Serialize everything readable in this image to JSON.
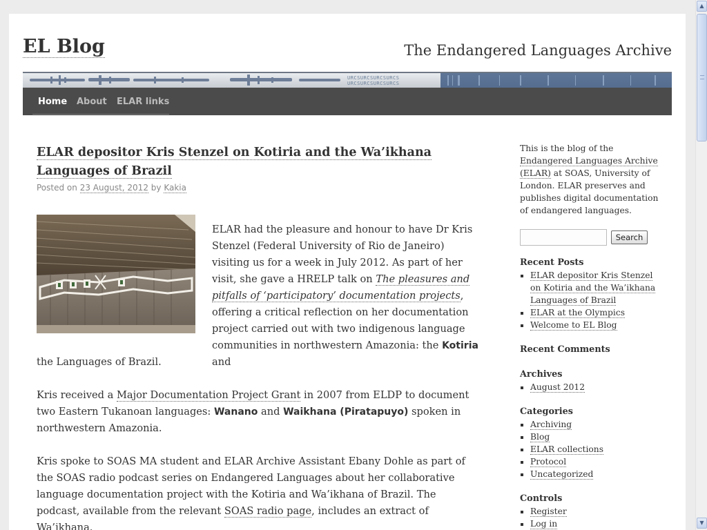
{
  "site": {
    "title": "EL Blog",
    "description": "The Endangered Languages Archive",
    "banner_text": "URCSURCSURCSURCS\nURCSURCSURCSURCS"
  },
  "nav": {
    "items": [
      "Home",
      "About",
      "ELAR links"
    ],
    "active": "Home"
  },
  "post": {
    "title": "ELAR depositor Kris Stenzel on Kotiria and the Wa’ikhana Languages of Brazil",
    "meta_prefix": "Posted on",
    "date": "23 August, 2012",
    "meta_by": "by",
    "author": "Kakia",
    "p1_a": "ELAR had the pleasure and honour to have Dr Kris Stenzel (Federal University of Rio de Janeiro) visiting us for a week in July 2012. As part of her visit, she gave a HRELP talk on ",
    "p1_link": "The pleasures and pitfalls of ‘participatory’ documentation projects",
    "p1_b": ", offering a critical reflection on her documentation project carried out with two indigenous language communities in northwestern Amazonia: the ",
    "p1_lang": "Kotiria",
    "p1_c": " and",
    "p1_d": "the Languages of Brazil.",
    "p2_a": "Kris received a ",
    "p2_link": "Major Documentation Project Grant",
    "p2_b": " in 2007 from ELDP to document two Eastern Tukanoan languages: ",
    "p2_lang1": "Wanano",
    "p2_c": " and ",
    "p2_lang2": "Waikhana (Piratapuyo)",
    "p2_d": " spoken in northwestern Amazonia.",
    "p3_a": "Kris spoke to SOAS MA student and ELAR Archive Assistant Ebany Dohle as part of the SOAS radio podcast series on Endangered Languages about her collaborative language documentation project with the Kotiria and Wa’ikhana of Brazil. The podcast, available from the relevant ",
    "p3_link": "SOAS radio page",
    "p3_b": ", includes an extract of Wa’ikhana."
  },
  "sidebar": {
    "intro_a": "This is the blog of the ",
    "intro_link": "Endangered Languages Archive (ELAR)",
    "intro_b": " at SOAS, University of London. ELAR preserves and publishes digital documentation of endangered languages.",
    "search_placeholder": "",
    "search_button": "Search",
    "recent_posts_title": "Recent Posts",
    "recent_posts": [
      "ELAR depositor Kris Stenzel on Kotiria and the Wa’ikhana Languages of Brazil",
      "ELAR at the Olympics",
      "Welcome to EL Blog"
    ],
    "recent_comments_title": "Recent Comments",
    "archives_title": "Archives",
    "archives": [
      "August 2012"
    ],
    "categories_title": "Categories",
    "categories": [
      "Archiving",
      "Blog",
      "ELAR collections",
      "Protocol",
      "Uncategorized"
    ],
    "controls_title": "Controls",
    "controls": [
      "Register",
      "Log in"
    ]
  },
  "colors": {
    "nav_bg": "#4b4b4b",
    "page_bg": "#ececec",
    "text": "#333333"
  }
}
